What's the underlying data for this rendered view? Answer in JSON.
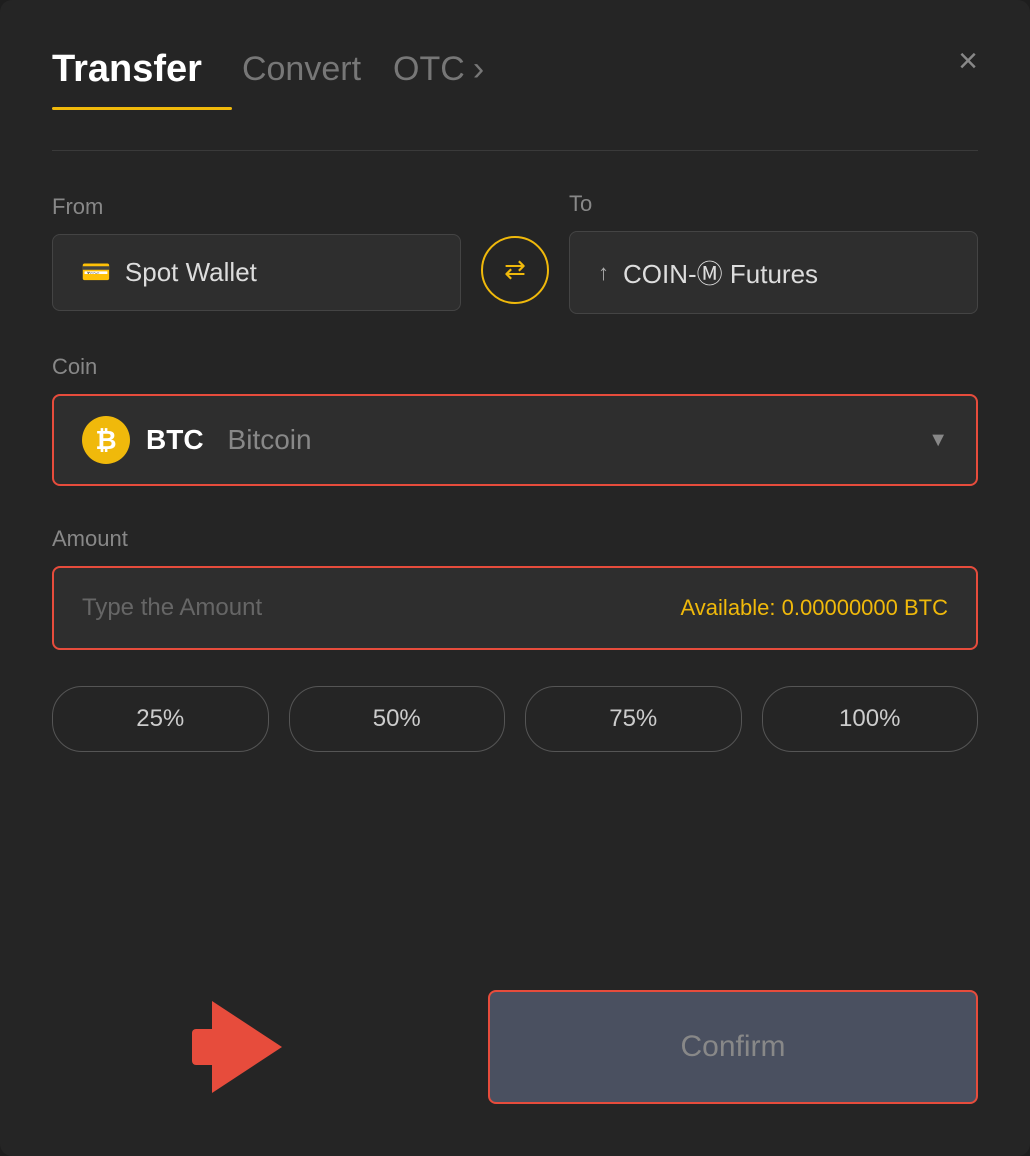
{
  "header": {
    "tab_transfer": "Transfer",
    "tab_convert": "Convert",
    "tab_otc": "OTC",
    "close_label": "×"
  },
  "from": {
    "label": "From",
    "wallet_text": "Spot Wallet",
    "wallet_icon": "💳"
  },
  "swap": {
    "icon": "⇄"
  },
  "to": {
    "label": "To",
    "wallet_text": "COIN-Ⓜ Futures",
    "futures_icon": "↑"
  },
  "coin": {
    "label": "Coin",
    "symbol": "BTC",
    "name": "Bitcoin",
    "icon_letter": "₿"
  },
  "amount": {
    "label": "Amount",
    "placeholder": "Type the Amount",
    "available_label": "Available:",
    "available_value": "0.00000000 BTC"
  },
  "percentages": [
    "25%",
    "50%",
    "75%",
    "100%"
  ],
  "confirm_button": "Confirm"
}
